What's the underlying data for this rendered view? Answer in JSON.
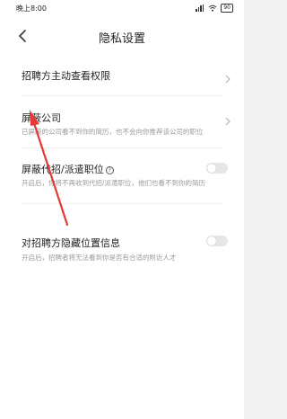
{
  "status_bar": {
    "time": "晚上8:00",
    "battery": "90"
  },
  "nav": {
    "title": "隐私设置"
  },
  "settings": [
    {
      "title": "招聘方主动查看权限",
      "control": "chevron"
    },
    {
      "title": "屏蔽公司",
      "description": "已屏蔽的公司看不到你的简历，也不会向你推荐该公司的职位",
      "control": "chevron"
    },
    {
      "title": "屏蔽代招/派遣职位",
      "description": "开启后，你将不再收到代招/派遣职位，他们也看不到你的简历",
      "control": "toggle",
      "enabled": false
    },
    {
      "title": "对招聘方隐藏位置信息",
      "description": "开启后，招聘者将无法看到你是否有合适的附近人才",
      "control": "toggle",
      "enabled": false
    }
  ],
  "colors": {
    "annotation_arrow": "#e53935",
    "toggle_off": "#e6e6e6"
  }
}
